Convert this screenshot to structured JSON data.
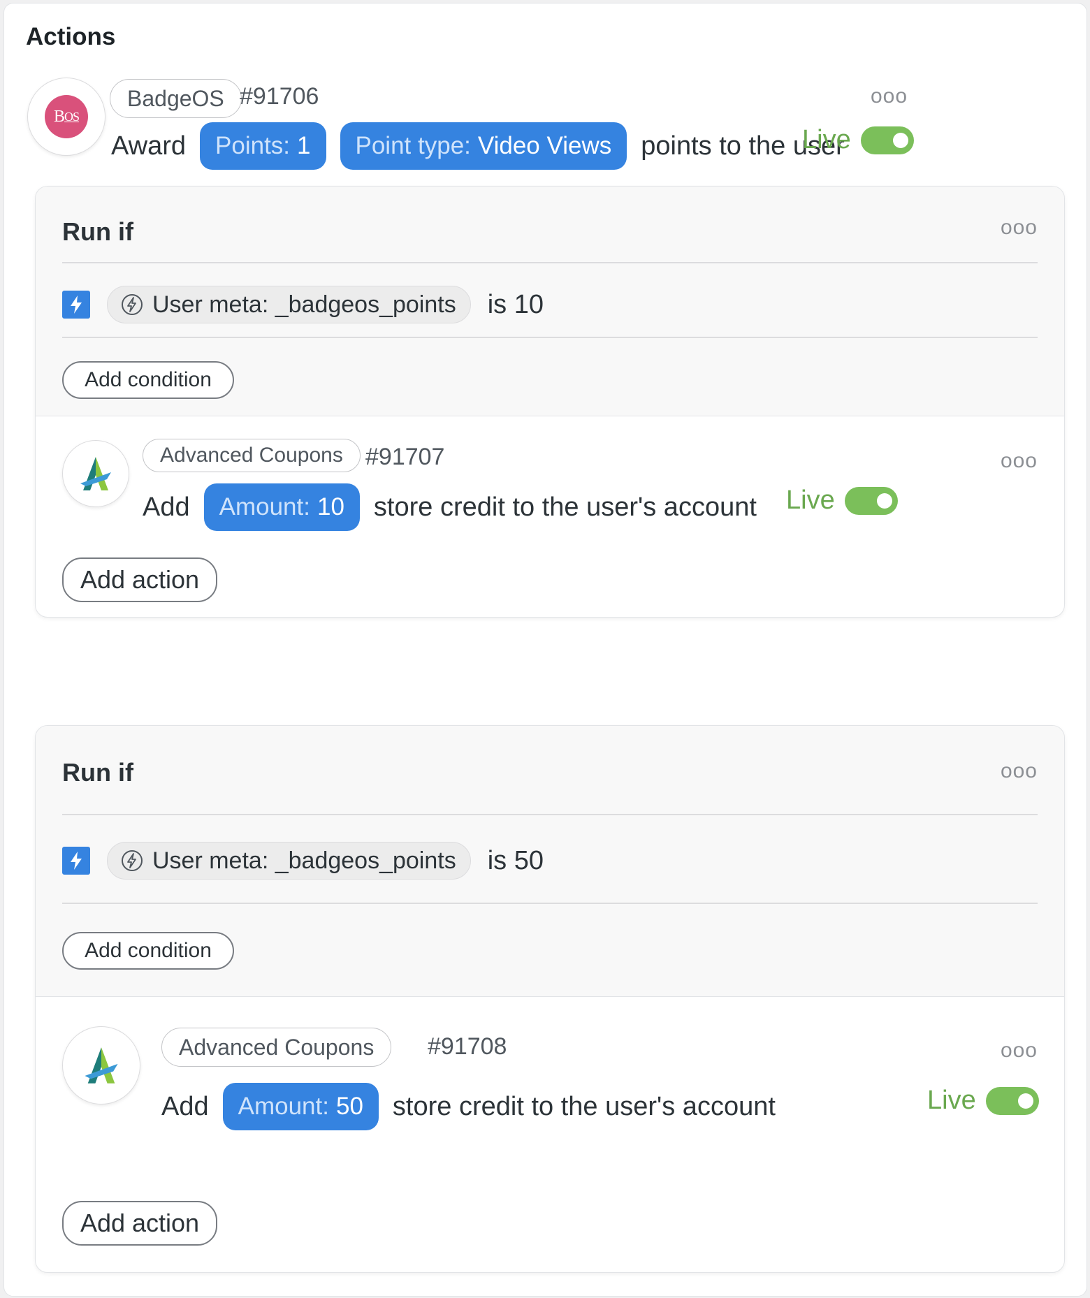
{
  "section_title": "Actions",
  "main_action": {
    "integration": "BadgeOS",
    "logo_text": "B",
    "logo_text_sub": "OS",
    "id": "#91706",
    "verb": "Award",
    "chips": [
      {
        "key": "Points:",
        "value": "1"
      },
      {
        "key": "Point type:",
        "value": "Video Views"
      }
    ],
    "suffix": "points to the user",
    "status": "Live",
    "menu": "ooo"
  },
  "blocks": [
    {
      "title": "Run if",
      "menu": "ooo",
      "condition": {
        "meta_label": "User meta: _badgeos_points",
        "operator_text": "is 10"
      },
      "add_condition_label": "Add condition",
      "action": {
        "integration": "Advanced Coupons",
        "id": "#91707",
        "verb": "Add",
        "chip": {
          "key": "Amount:",
          "value": "10"
        },
        "suffix": "store credit to the user's account",
        "status": "Live",
        "menu": "ooo"
      },
      "add_action_label": "Add action"
    },
    {
      "title": "Run if",
      "menu": "ooo",
      "condition": {
        "meta_label": "User meta: _badgeos_points",
        "operator_text": "is 50"
      },
      "add_condition_label": "Add condition",
      "action": {
        "integration": "Advanced Coupons",
        "id": "#91708",
        "verb": "Add",
        "chip": {
          "key": "Amount:",
          "value": "50"
        },
        "suffix": "store credit to the user's account",
        "status": "Live",
        "menu": "ooo"
      },
      "add_action_label": "Add action"
    }
  ],
  "colors": {
    "chip_blue": "#3583e0",
    "live_green": "#6aa84f",
    "toggle_green": "#7bbf5a",
    "badgeos_pink": "#d9517b"
  }
}
